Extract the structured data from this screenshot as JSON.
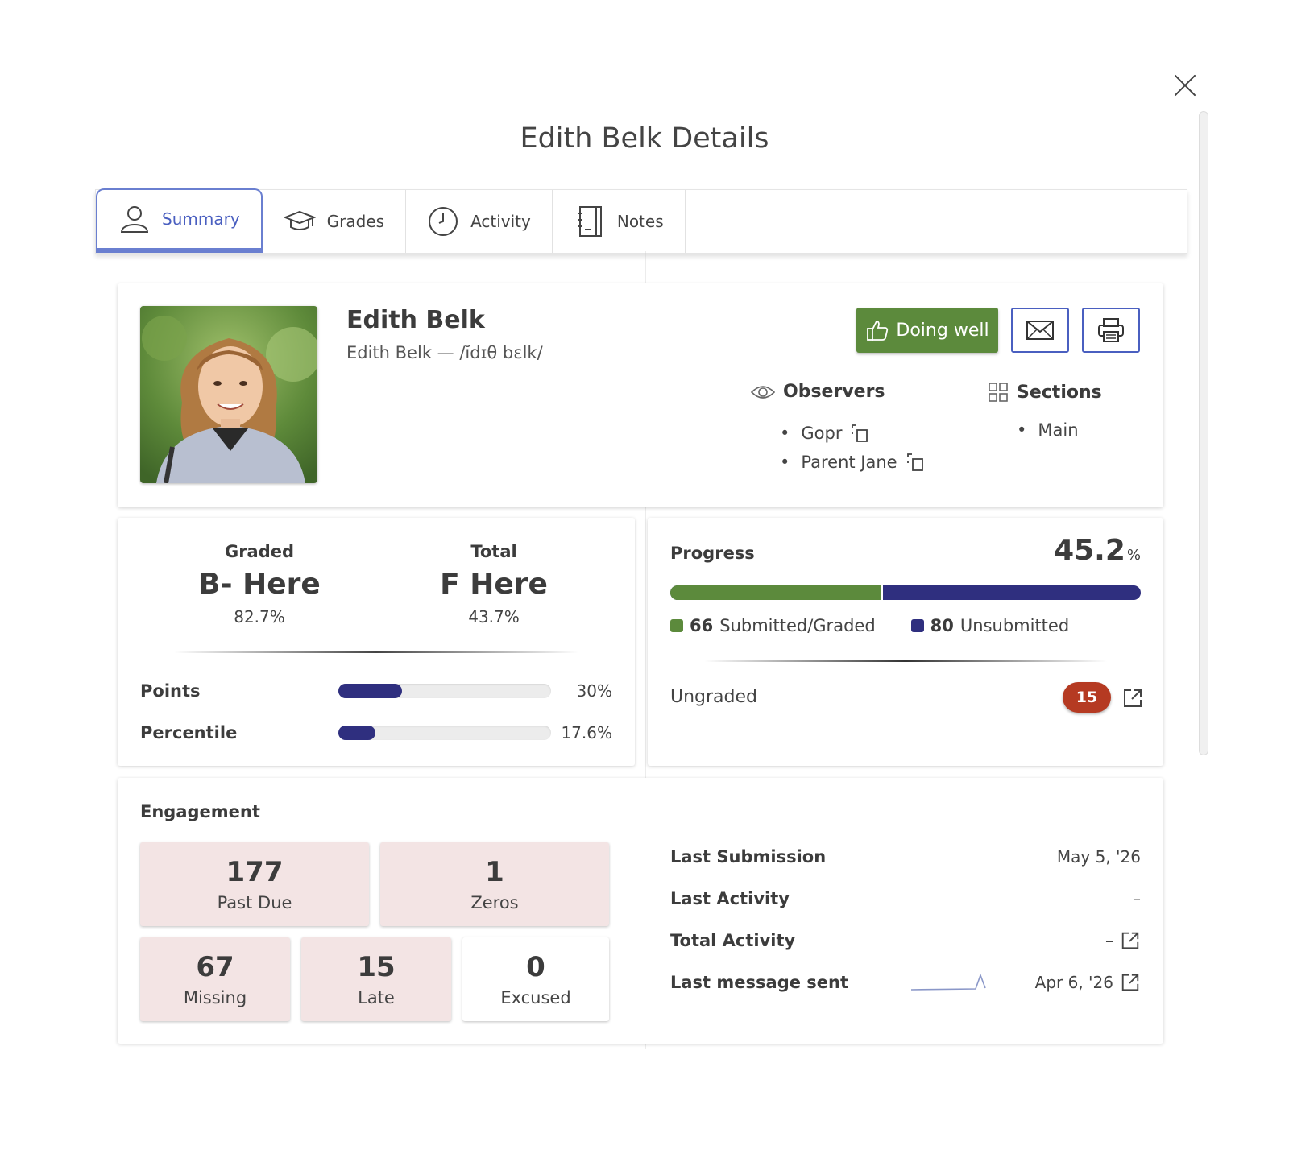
{
  "dialog": {
    "title": "Edith Belk Details"
  },
  "tabs": [
    {
      "label": "Summary",
      "icon": "user-icon",
      "active": true
    },
    {
      "label": "Grades",
      "icon": "graduation-cap-icon",
      "active": false
    },
    {
      "label": "Activity",
      "icon": "clock-icon",
      "active": false
    },
    {
      "label": "Notes",
      "icon": "notebook-icon",
      "active": false
    }
  ],
  "profile": {
    "name": "Edith Belk",
    "pronunciation": "Edith Belk — /ĭdɪθ bɛlk/",
    "status_button": "Doing well",
    "observers_heading": "Observers",
    "observers": [
      "Gopr",
      "Parent Jane"
    ],
    "sections_heading": "Sections",
    "sections": [
      "Main"
    ]
  },
  "grades": {
    "graded_label": "Graded",
    "graded_letter": "B- Here",
    "graded_pct": "82.7%",
    "total_label": "Total",
    "total_letter": "F Here",
    "total_pct": "43.7%",
    "points_label": "Points",
    "points_value": "30%",
    "points_fraction": 0.3,
    "percentile_label": "Percentile",
    "percentile_value": "17.6%",
    "percentile_fraction": 0.176
  },
  "progress": {
    "label": "Progress",
    "value": "45.2",
    "unit": "%",
    "submitted_count": "66",
    "submitted_label": "Submitted/Graded",
    "unsubmitted_count": "80",
    "unsubmitted_label": "Unsubmitted",
    "ungraded_label": "Ungraded",
    "ungraded_count": "15"
  },
  "engagement": {
    "title": "Engagement",
    "tiles": {
      "past_due": {
        "num": "177",
        "label": "Past Due"
      },
      "zeros": {
        "num": "1",
        "label": "Zeros"
      },
      "missing": {
        "num": "67",
        "label": "Missing"
      },
      "late": {
        "num": "15",
        "label": "Late"
      },
      "excused": {
        "num": "0",
        "label": "Excused"
      }
    },
    "stats": {
      "last_submission_label": "Last Submission",
      "last_submission_value": "May 5, '26",
      "last_activity_label": "Last Activity",
      "last_activity_value": "–",
      "total_activity_label": "Total Activity",
      "total_activity_value": "–",
      "last_message_label": "Last message sent",
      "last_message_value": "Apr 6, '26"
    }
  },
  "colors": {
    "accent": "#4a5fc0",
    "success": "#5c8a3c",
    "navy": "#2f2f7f",
    "badge_red": "#b53a22",
    "tile_pink": "#f3e4e4"
  }
}
